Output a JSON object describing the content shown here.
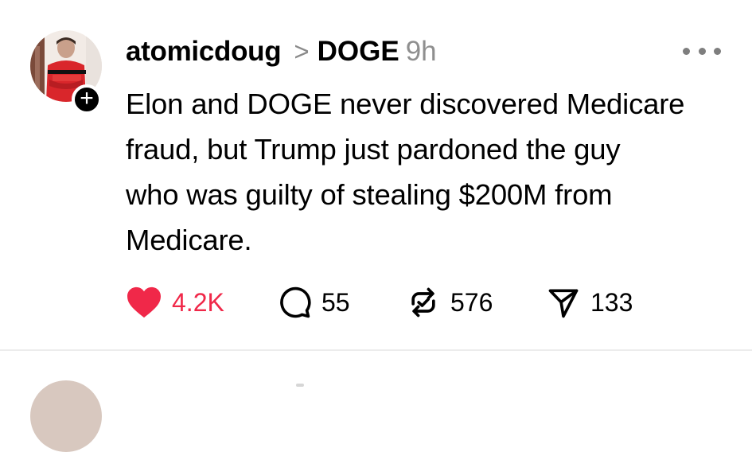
{
  "post": {
    "author": "atomicdoug",
    "separator": ">",
    "community": "DOGE",
    "time": "9h",
    "follow_symbol": "+",
    "body_lines": [
      "Elon and DOGE never discovered Medicare",
      "fraud, but Trump just pardoned the guy",
      "who was guilty of stealing $200M from",
      "Medicare."
    ]
  },
  "actions": {
    "likes": "4.2K",
    "replies": "55",
    "reposts": "576",
    "shares": "133"
  },
  "colors": {
    "like_active": "#f02849",
    "meta_gray": "#8f8f8f",
    "divider": "#ececec"
  },
  "icons": [
    "heart-icon",
    "reply-bubble-icon",
    "repost-icon",
    "share-send-icon",
    "more-options-icon",
    "plus-icon"
  ]
}
